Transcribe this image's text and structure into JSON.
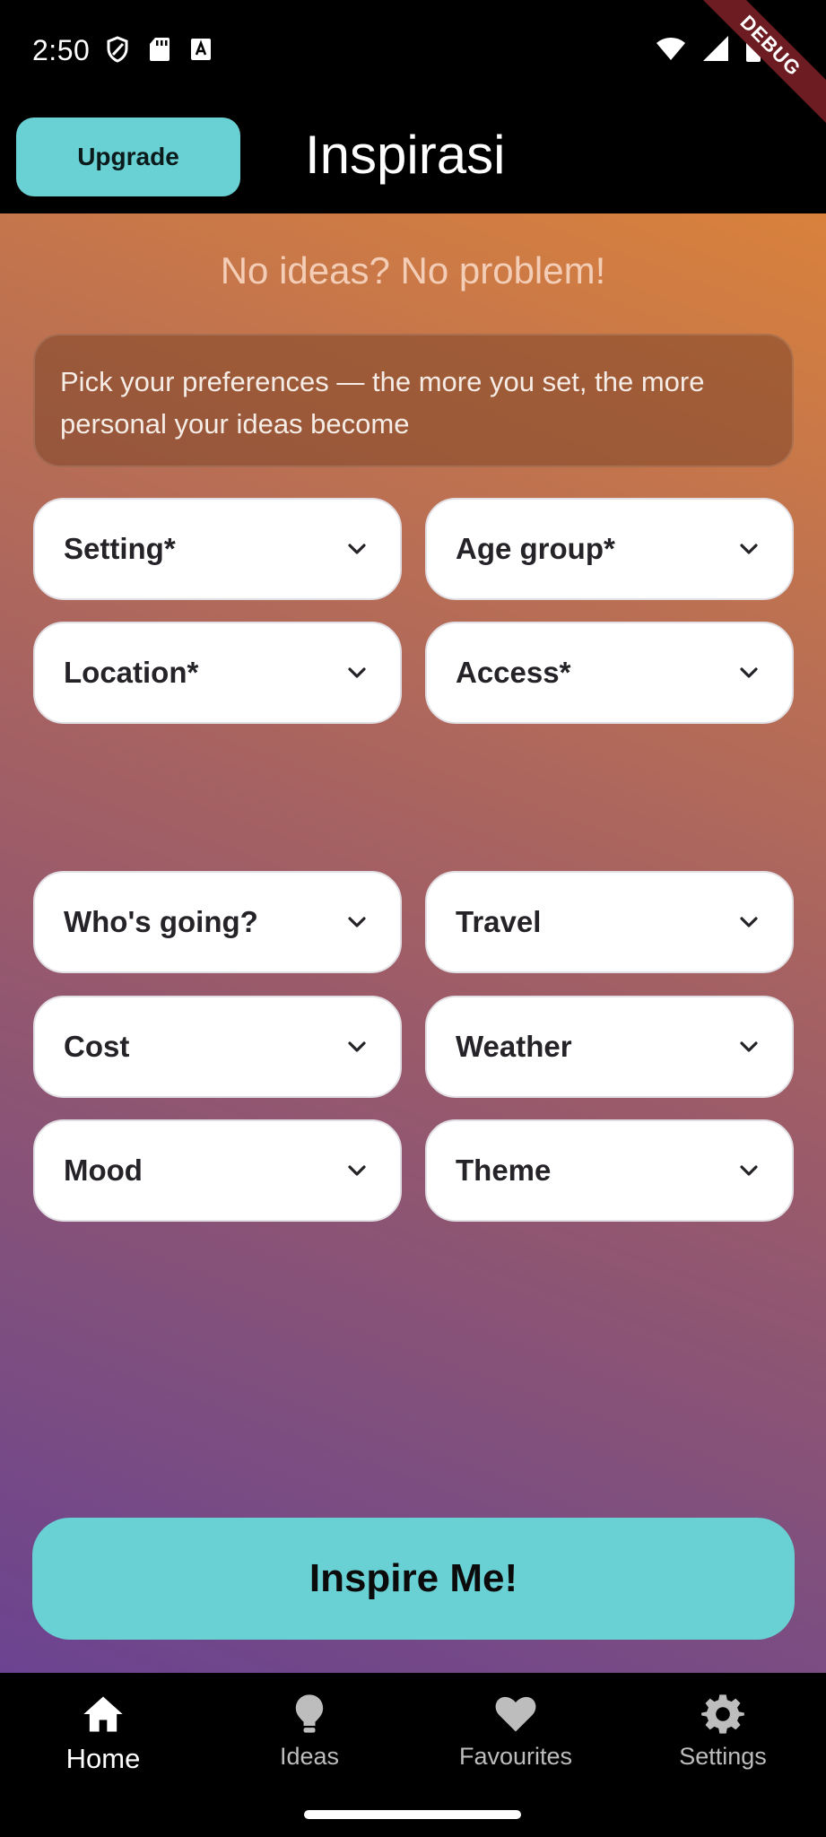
{
  "status_bar": {
    "time": "2:50",
    "left_icons": [
      "shield-icon",
      "sd-card-icon",
      "keyboard-a-icon"
    ],
    "right_icons": [
      "wifi-icon",
      "cell-signal-icon",
      "battery-icon"
    ],
    "debug_banner": "DEBUG"
  },
  "app_bar": {
    "upgrade_label": "Upgrade",
    "title": "Inspirasi"
  },
  "main": {
    "headline": "No ideas? No problem!",
    "info_text": "Pick your preferences — the more you set, the more personal your ideas become",
    "required_filters": [
      {
        "label": "Setting*"
      },
      {
        "label": "Age group*"
      },
      {
        "label": "Location*"
      },
      {
        "label": "Access*"
      }
    ],
    "optional_filters": [
      {
        "label": "Who's going?"
      },
      {
        "label": "Travel"
      },
      {
        "label": "Cost"
      },
      {
        "label": "Weather"
      },
      {
        "label": "Mood"
      },
      {
        "label": "Theme"
      }
    ],
    "inspire_label": "Inspire Me!"
  },
  "bottom_nav": {
    "items": [
      {
        "label": "Home",
        "icon": "home-icon",
        "active": true
      },
      {
        "label": "Ideas",
        "icon": "lightbulb-icon",
        "active": false
      },
      {
        "label": "Favourites",
        "icon": "heart-icon",
        "active": false
      },
      {
        "label": "Settings",
        "icon": "gear-icon",
        "active": false
      }
    ]
  },
  "colors": {
    "accent": "#69d0d4",
    "gradient_top": "#d9813c",
    "gradient_bottom": "#6b4390"
  }
}
